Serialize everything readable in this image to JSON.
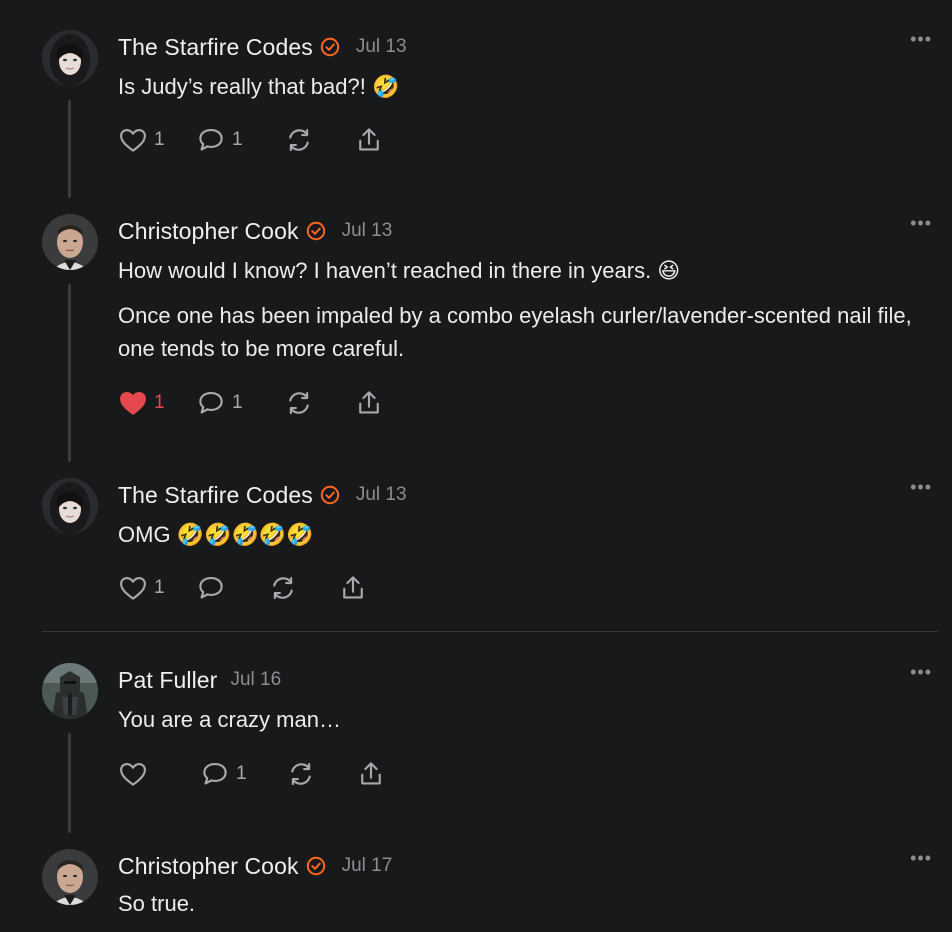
{
  "colors": {
    "background": "#18191b",
    "accent": "#ff6719",
    "like": "#e5484d",
    "muted": "#8b8d91"
  },
  "comments": [
    {
      "author": "The Starfire Codes",
      "verified": true,
      "date": "Jul 13",
      "paragraphs": [
        "Is Judy’s really that bad?! 🤣"
      ],
      "likes": "1",
      "replies": "1",
      "liked": false,
      "avatar": "woman-avatar"
    },
    {
      "author": "Christopher Cook",
      "verified": true,
      "date": "Jul 13",
      "paragraphs": [
        "How would I know? I haven’t reached in there in years. 😆",
        "Once one has been impaled by a combo eyelash curler/lavender-scented nail file, one tends to be more careful."
      ],
      "likes": "1",
      "replies": "1",
      "liked": true,
      "avatar": "man-avatar"
    },
    {
      "author": "The Starfire Codes",
      "verified": true,
      "date": "Jul 13",
      "paragraphs": [
        "OMG 🤣🤣🤣🤣🤣"
      ],
      "likes": "1",
      "replies": "",
      "liked": false,
      "avatar": "woman-avatar"
    },
    {
      "author": "Pat Fuller",
      "verified": false,
      "date": "Jul 16",
      "paragraphs": [
        "You are a crazy man…"
      ],
      "likes": "",
      "replies": "1",
      "liked": false,
      "avatar": "knight-avatar"
    },
    {
      "author": "Christopher Cook",
      "verified": true,
      "date": "Jul 17",
      "paragraphs": [
        "So true."
      ],
      "likes": "",
      "replies": "",
      "liked": false,
      "avatar": "man-avatar"
    }
  ],
  "more_label": "•••"
}
